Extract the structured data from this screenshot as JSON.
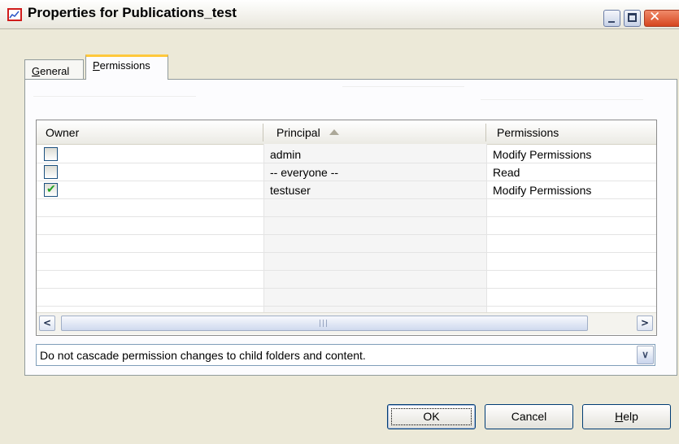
{
  "window": {
    "title": "Properties for Publications_test"
  },
  "tabs": [
    {
      "label_prefix": "",
      "label_accel": "G",
      "label_rest": "eneral",
      "selected": false
    },
    {
      "label_prefix": "",
      "label_accel": "P",
      "label_rest": "ermissions",
      "selected": true
    }
  ],
  "grid": {
    "columns": [
      "Owner",
      "Principal",
      "Permissions"
    ],
    "sorted_column": "Principal",
    "sort_direction": "ascending",
    "rows": [
      {
        "owner": false,
        "principal": "admin",
        "permissions": "Modify Permissions"
      },
      {
        "owner": false,
        "principal": "-- everyone --",
        "permissions": "Read"
      },
      {
        "owner": true,
        "principal": "testuser",
        "permissions": "Modify Permissions"
      }
    ]
  },
  "cascade_select": {
    "value": "Do not cascade permission changes to child folders and content."
  },
  "buttons": {
    "ok": "OK",
    "cancel": "Cancel",
    "help_accel": "H",
    "help_rest": "elp"
  },
  "icons": {
    "app": "chart-document-icon",
    "minimize": "minimize-icon",
    "maximize": "maximize-icon",
    "close": "close-icon",
    "scroll_left": "chevron-left-icon",
    "scroll_right": "chevron-right-icon",
    "dropdown": "chevron-down-icon",
    "sort": "sort-ascending-icon"
  },
  "colors": {
    "active_tab_accent": "#ffc83c",
    "close_button": "#d6461f",
    "checkmark": "#21a121"
  }
}
